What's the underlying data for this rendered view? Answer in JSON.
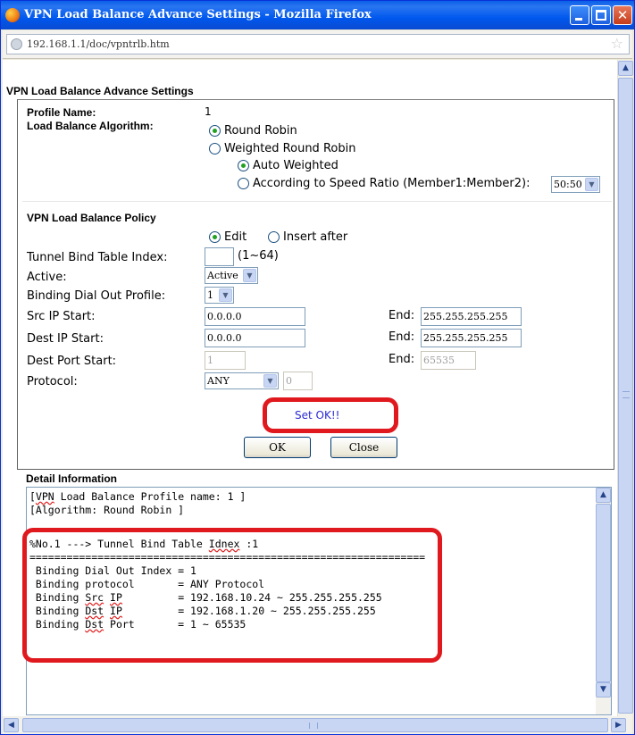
{
  "window": {
    "title": "VPN Load Balance Advance Settings - Mozilla Firefox",
    "url": "192.168.1.1/doc/vpntrlb.htm"
  },
  "page": {
    "title": "VPN Load Balance Advance Settings",
    "profile_name_label": "Profile Name:",
    "profile_name_value": "1",
    "algorithm_label": "Load Balance Algorithm:",
    "algorithm_options": [
      "Round Robin",
      "Weighted Round Robin"
    ],
    "weighted_sub_options": [
      "Auto Weighted",
      "According to Speed Ratio (Member1:Member2):"
    ],
    "speed_ratio_value": "50:50"
  },
  "policy": {
    "title": "VPN Load Balance Policy",
    "mode_options": [
      "Edit",
      "Insert after"
    ],
    "tunnel_index_label": "Tunnel Bind Table Index:",
    "tunnel_index_value": "",
    "tunnel_index_range": "(1~64)",
    "active_label": "Active:",
    "active_value": "Active",
    "dial_out_label": "Binding Dial Out Profile:",
    "dial_out_value": "1",
    "src_ip_label": "Src IP Start:",
    "src_ip_start": "0.0.0.0",
    "src_ip_end_label": "End:",
    "src_ip_end": "255.255.255.255",
    "dest_ip_label": "Dest IP Start:",
    "dest_ip_start": "0.0.0.0",
    "dest_ip_end_label": "End:",
    "dest_ip_end": "255.255.255.255",
    "dest_port_label": "Dest Port Start:",
    "dest_port_start": "1",
    "dest_port_end_label": "End:",
    "dest_port_end": "65535",
    "protocol_label": "Protocol:",
    "protocol_value": "ANY",
    "protocol_number": "0",
    "status_message": "Set OK!!",
    "ok_label": "OK",
    "close_label": "Close"
  },
  "detail": {
    "title": "Detail Information",
    "lines": [
      "[VPN Load Balance Profile name: 1 ]",
      "[Algorithm: Round Robin ]",
      "",
      "%No.1 ---> Tunnel Bind Table Idnex :1",
      "================================================================",
      " Binding Dial Out Index = 1",
      " Binding protocol       = ANY Protocol",
      " Binding Src IP         = 192.168.10.24 ~ 255.255.255.255",
      " Binding Dst IP         = 192.168.1.20 ~ 255.255.255.255",
      " Binding Dst Port       = 1 ~ 65535"
    ]
  },
  "colors": {
    "highlight": "#e0191e",
    "status_text": "#2b2bd5",
    "titlebar": "#0058ee"
  }
}
